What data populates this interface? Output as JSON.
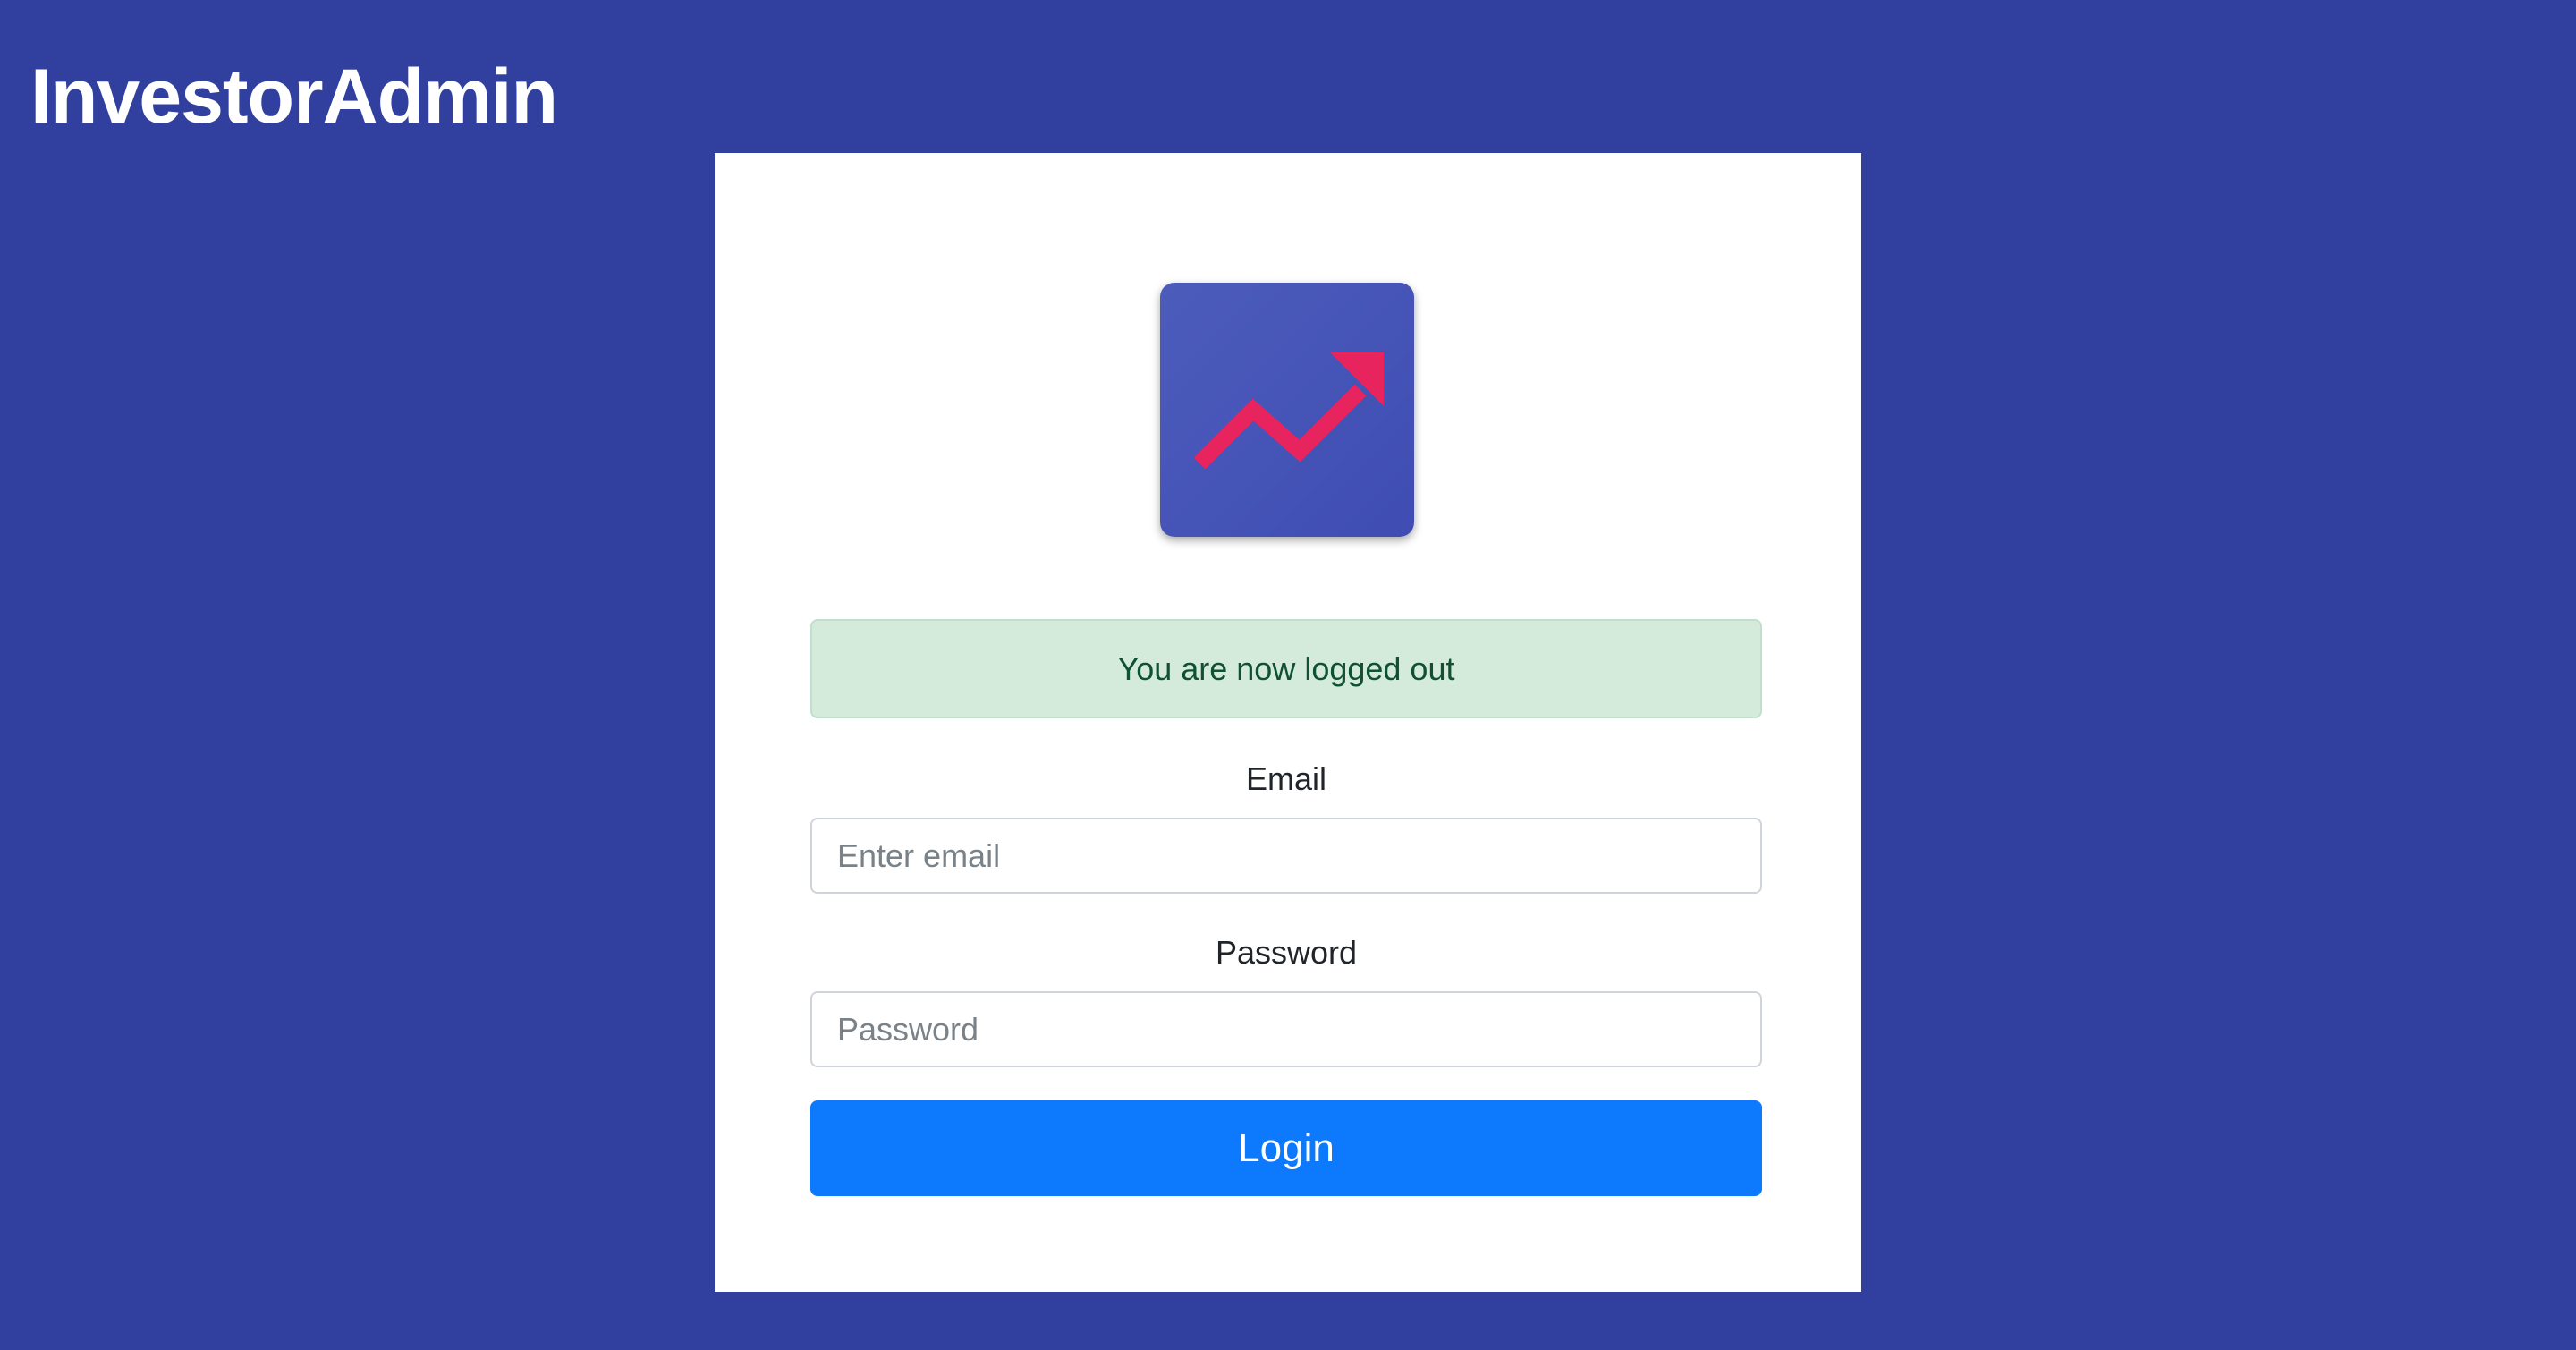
{
  "app": {
    "brand_title": "InvestorAdmin"
  },
  "logo": {
    "icon": "trending-up-arrow-icon",
    "background_color": "#4352b5",
    "arrow_color": "#e8245f"
  },
  "alert": {
    "message": "You are now logged out",
    "type": "success"
  },
  "form": {
    "email": {
      "label": "Email",
      "placeholder": "Enter email",
      "value": ""
    },
    "password": {
      "label": "Password",
      "placeholder": "Password",
      "value": ""
    },
    "login_label": "Login"
  },
  "colors": {
    "page_background": "#31409e",
    "primary_button": "#0d79fd",
    "alert_background": "#d4eadb",
    "alert_text": "#0f5132"
  }
}
